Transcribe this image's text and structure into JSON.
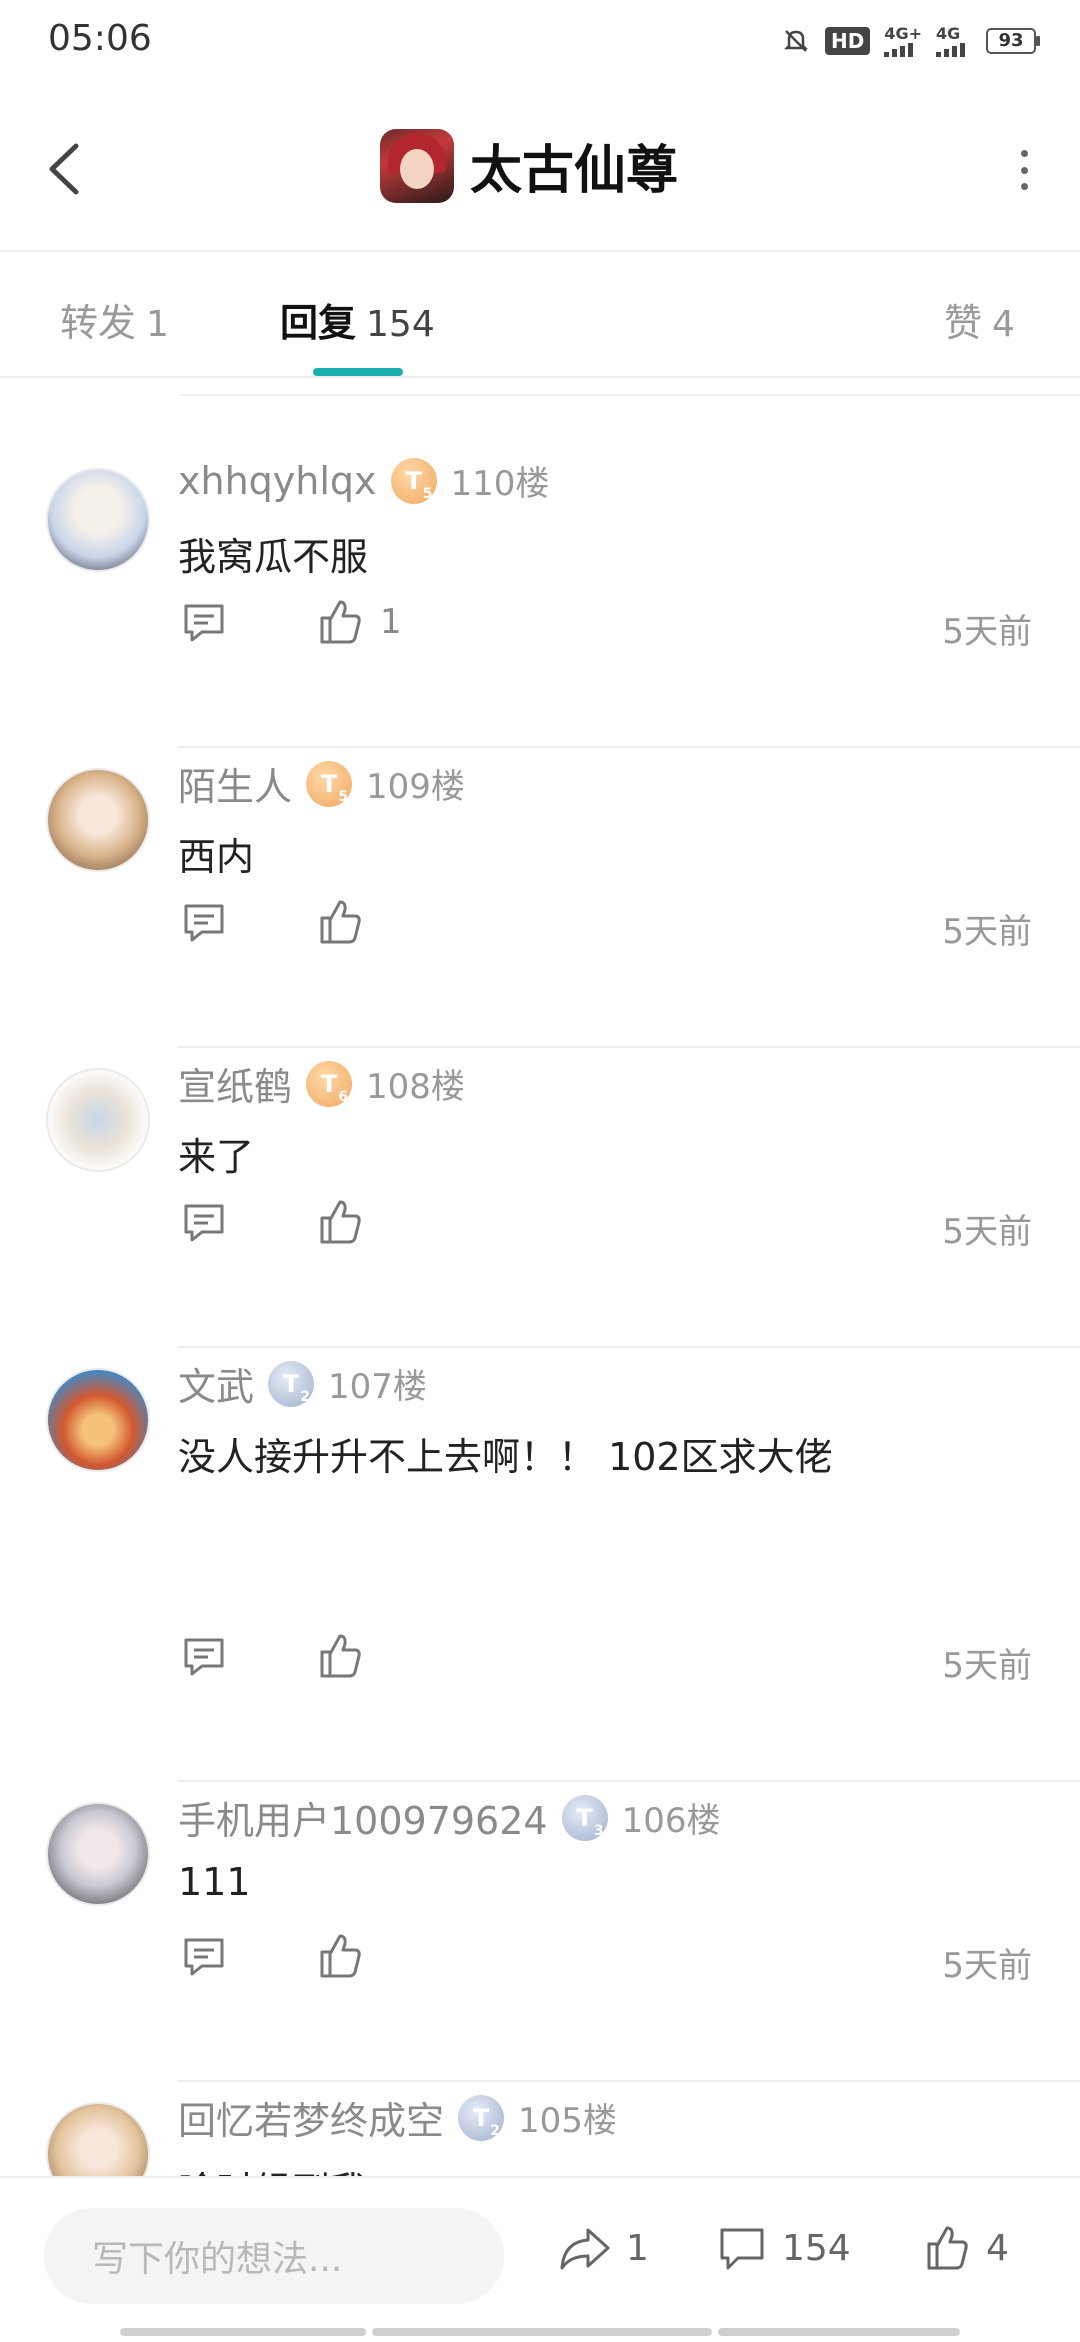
{
  "status_bar": {
    "time": "05:06",
    "hd_label": "HD",
    "network_1": "4G+",
    "network_2": "4G",
    "battery": "93"
  },
  "header": {
    "title": "太古仙尊"
  },
  "tabs": [
    {
      "label": "转发",
      "count": "1"
    },
    {
      "label": "回复",
      "count": "154"
    },
    {
      "label": "赞",
      "count": "4"
    }
  ],
  "replies": [
    {
      "user": "xhhqyhlqx",
      "level": "5",
      "badge": "gold",
      "floor": "110楼",
      "content": "我窝瓜不服",
      "likes": "1",
      "time": "5天前"
    },
    {
      "user": "陌生人",
      "level": "5",
      "badge": "gold",
      "floor": "109楼",
      "content": "西内",
      "likes": "",
      "time": "5天前"
    },
    {
      "user": "宣纸鹤",
      "level": "6",
      "badge": "gold",
      "floor": "108楼",
      "content": "来了",
      "likes": "",
      "time": "5天前"
    },
    {
      "user": "文武",
      "level": "2",
      "badge": "silver",
      "floor": "107楼",
      "content": "没人接升升不上去啊！！ 102区求大佬",
      "likes": "",
      "time": "5天前"
    },
    {
      "user": "手机用户100979624",
      "level": "3",
      "badge": "silver",
      "floor": "106楼",
      "content": "111",
      "likes": "",
      "time": "5天前"
    },
    {
      "user": "回忆若梦终成空",
      "level": "2",
      "badge": "silver",
      "floor": "105楼",
      "content": "啥时候到我",
      "likes": "",
      "time": ""
    }
  ],
  "bottom_bar": {
    "input_placeholder": "写下你的想法...",
    "share_count": "1",
    "comment_count": "154",
    "like_count": "4"
  },
  "colors": {
    "accent": "#1aafaf",
    "badge_gold": "#f0a860",
    "badge_silver": "#9fb0cc"
  }
}
